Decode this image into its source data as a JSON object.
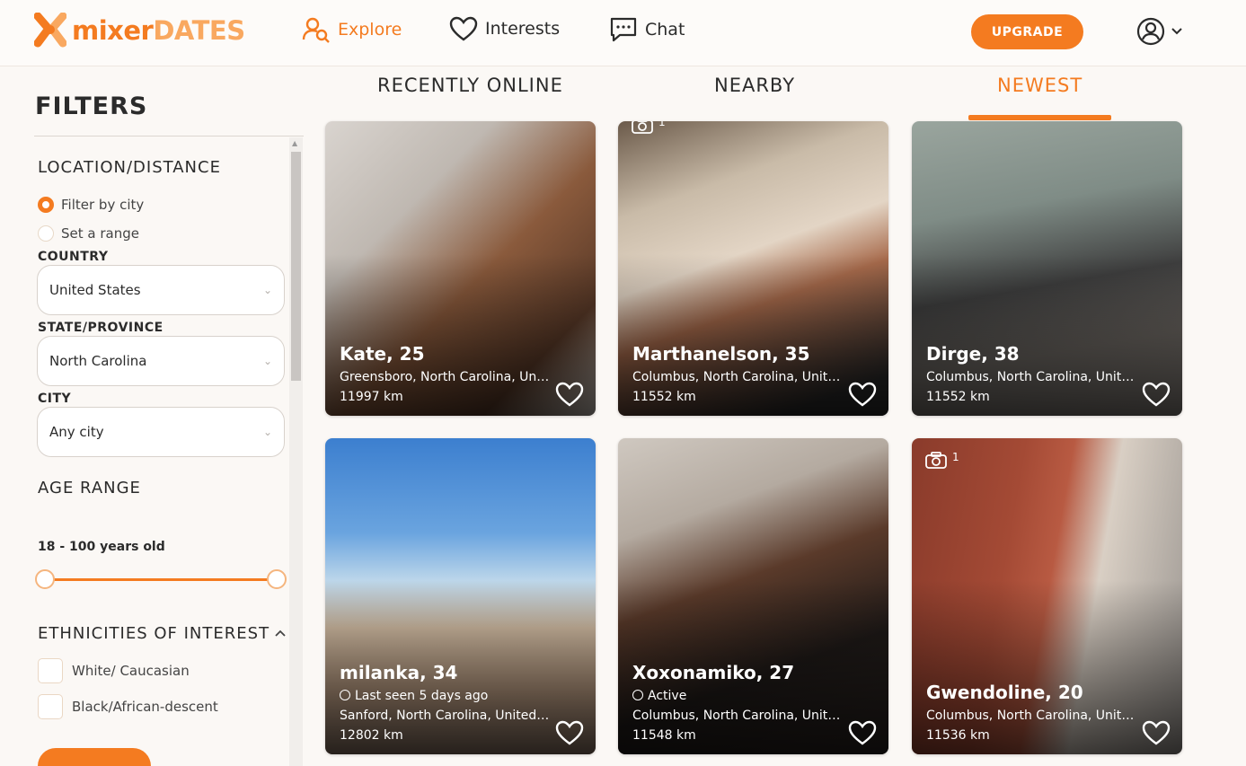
{
  "header": {
    "logo": {
      "part1": "mixer",
      "part2": "DATES"
    },
    "nav": {
      "explore": "Explore",
      "interests": "Interests",
      "chat": "Chat"
    },
    "upgrade_label": "UPGRADE",
    "colors": {
      "accent": "#f47b20",
      "accent_light": "#f9a860"
    }
  },
  "sidebar": {
    "title": "FILTERS",
    "location": {
      "title": "LOCATION/DISTANCE",
      "options": [
        "Filter by city",
        "Set a range"
      ],
      "selected": "Filter by city",
      "country_label": "COUNTRY",
      "country_value": "United States",
      "state_label": "STATE/PROVINCE",
      "state_value": "North Carolina",
      "city_label": "CITY",
      "city_value": "Any city"
    },
    "age": {
      "title": "AGE RANGE",
      "value_text": "18 - 100 years old",
      "min": 18,
      "max": 100
    },
    "ethnicities": {
      "title": "ETHNICITIES OF INTEREST",
      "options": [
        "White/ Caucasian",
        "Black/African-descent"
      ]
    }
  },
  "tabs": [
    {
      "label": "RECENTLY ONLINE"
    },
    {
      "label": "NEARBY"
    },
    {
      "label": "NEWEST"
    }
  ],
  "active_tab": "NEWEST",
  "profiles": [
    {
      "name": "Kate, 25",
      "location": "Greensboro, North Carolina, Unite...",
      "distance": "11997 km",
      "status": "",
      "photos": ""
    },
    {
      "name": "Marthanelson, 35",
      "location": "Columbus, North Carolina, United ...",
      "distance": "11552 km",
      "status": "",
      "photos": "1"
    },
    {
      "name": "Dirge, 38",
      "location": "Columbus, North Carolina, United ...",
      "distance": "11552 km",
      "status": "",
      "photos": ""
    },
    {
      "name": "milanka, 34",
      "location": "Sanford, North Carolina, United St...",
      "distance": "12802 km",
      "status": "Last seen 5 days ago",
      "photos": ""
    },
    {
      "name": "Xoxonamiko, 27",
      "location": "Columbus, North Carolina, United ...",
      "distance": "11548 km",
      "status": "Active",
      "photos": ""
    },
    {
      "name": "Gwendoline, 20",
      "location": "Columbus, North Carolina, United ...",
      "distance": "11536 km",
      "status": "",
      "photos": "1"
    }
  ]
}
